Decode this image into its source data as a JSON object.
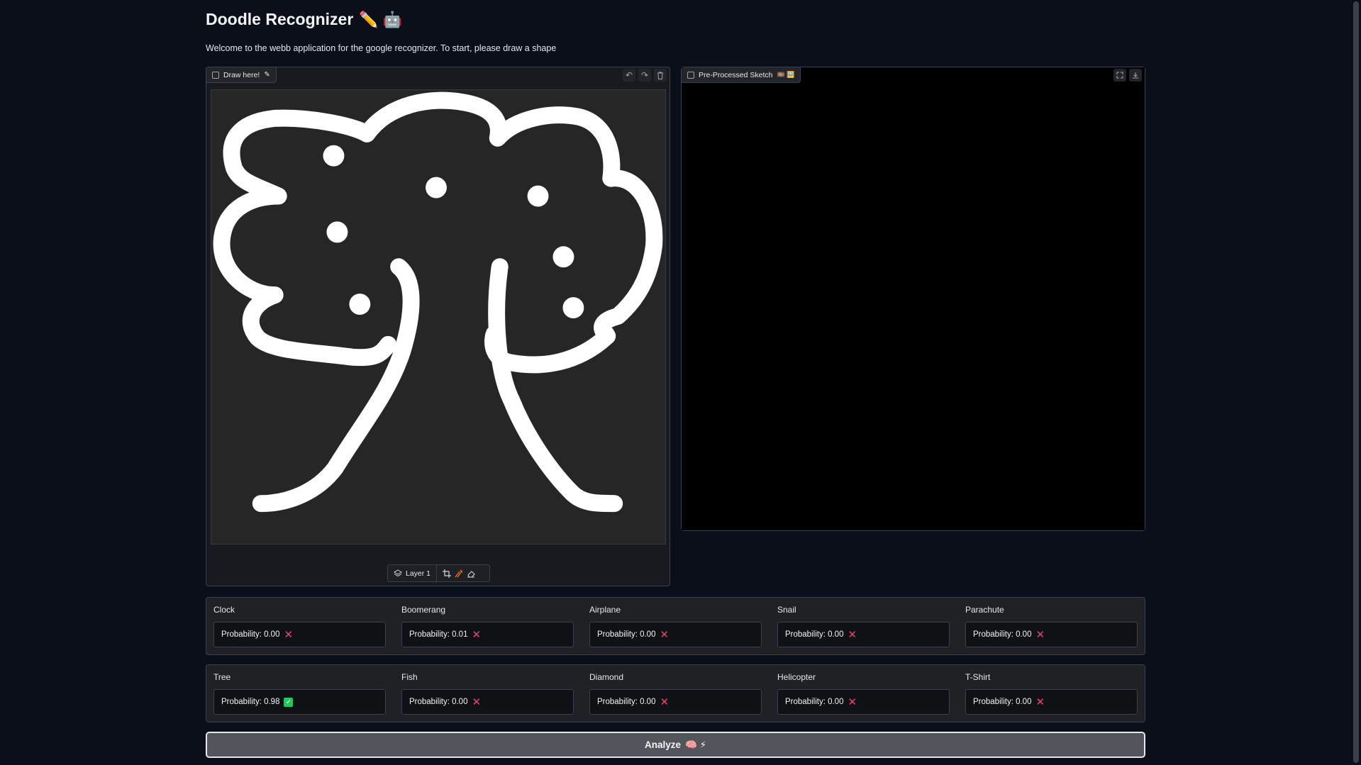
{
  "header": {
    "title": "Doodle Recognizer",
    "title_emojis": "✏️ 🤖",
    "intro": "Welcome to the webb application for the google recognizer. To start, please draw a shape"
  },
  "draw_panel": {
    "label": "Draw here!",
    "label_icon": "pen-icon",
    "tools": [
      "undo-icon",
      "redo-icon",
      "trash-icon"
    ],
    "layer_label": "Layer 1",
    "layer_tools": [
      "layers-icon",
      "crop-icon",
      "brush-icon",
      "eraser-icon"
    ]
  },
  "sketch_panel": {
    "label": "Pre-Processed Sketch",
    "label_icons": "🎞️ 🖼️",
    "tools": [
      "fullscreen-icon",
      "download-icon"
    ]
  },
  "results": {
    "row1": [
      {
        "label": "Clock",
        "value": "Probability: 0.00",
        "status": "x"
      },
      {
        "label": "Boomerang",
        "value": "Probability: 0.01",
        "status": "x"
      },
      {
        "label": "Airplane",
        "value": "Probability: 0.00",
        "status": "x"
      },
      {
        "label": "Snail",
        "value": "Probability: 0.00",
        "status": "x"
      },
      {
        "label": "Parachute",
        "value": "Probability: 0.00",
        "status": "x"
      }
    ],
    "row2": [
      {
        "label": "Tree",
        "value": "Probability: 0.98",
        "status": "check"
      },
      {
        "label": "Fish",
        "value": "Probability: 0.00",
        "status": "x"
      },
      {
        "label": "Diamond",
        "value": "Probability: 0.00",
        "status": "x"
      },
      {
        "label": "Helicopter",
        "value": "Probability: 0.00",
        "status": "x"
      },
      {
        "label": "T-Shirt",
        "value": "Probability: 0.00",
        "status": "x"
      }
    ]
  },
  "analyze": {
    "label": "Analyze",
    "emojis": "🧠 ⚡"
  },
  "colors": {
    "background": "#0b0f19",
    "wrong": "#ef4467",
    "correct": "#22c55e"
  }
}
